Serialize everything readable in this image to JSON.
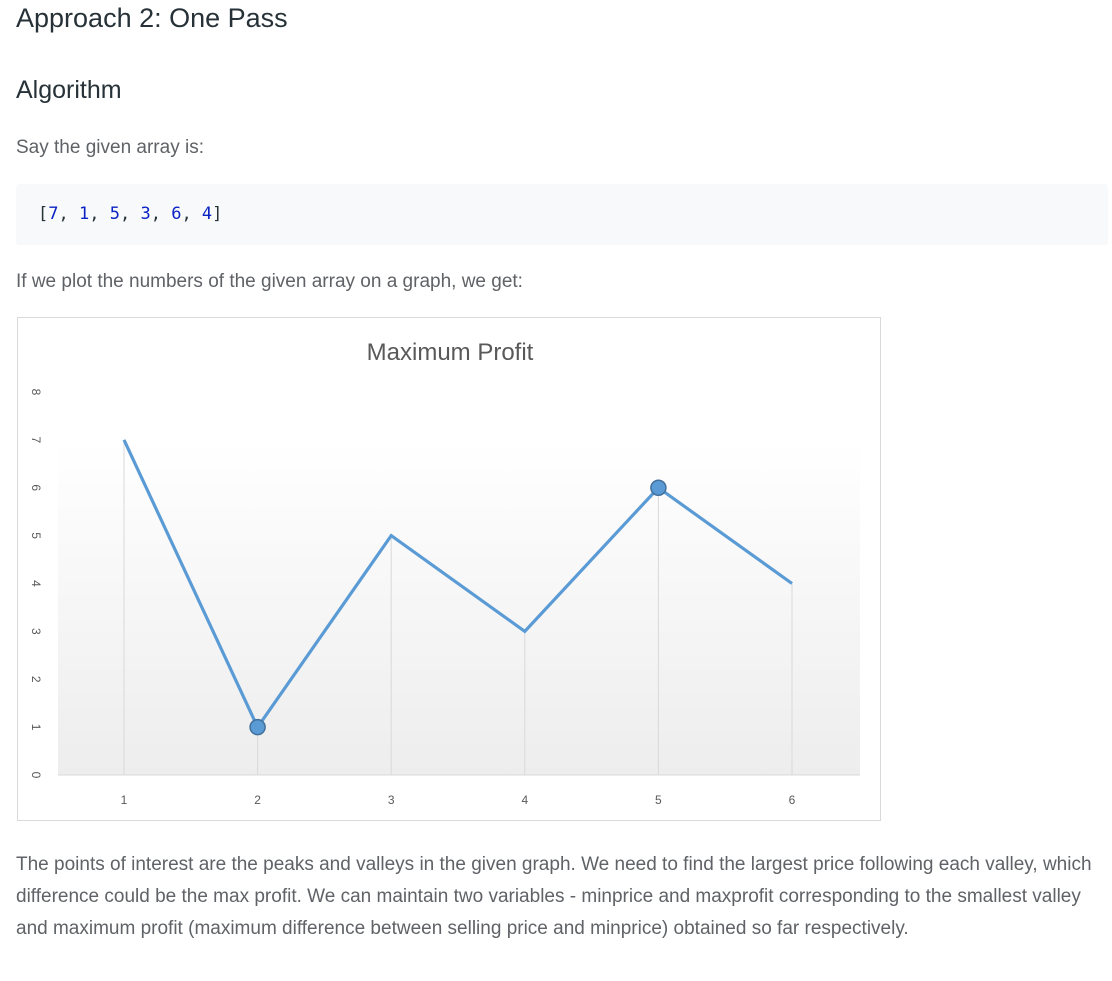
{
  "heading": "Approach 2: One Pass",
  "subheading": "Algorithm",
  "intro_text": "Say the given array is:",
  "code": {
    "open": "[",
    "close": "]",
    "separator": ", ",
    "values": [
      "7",
      "1",
      "5",
      "3",
      "6",
      "4"
    ]
  },
  "plot_text": "If we plot the numbers of the given array on a graph, we get:",
  "explanation": "The points of interest are the peaks and valleys in the given graph. We need to find the largest price following each valley, which difference could be the max profit. We can maintain two variables - minprice and maxprofit corresponding to the smallest valley and maximum profit (maximum difference between selling price and minprice) obtained so far respectively.",
  "colors": {
    "line": "#5b9bd5",
    "marker": "#5b9bd5",
    "marker_outline": "#41719c",
    "code_number": "#0b22c4",
    "heading": "#263238",
    "body_text": "#5f6266"
  },
  "chart_data": {
    "type": "line",
    "title": "Maximum Profit",
    "x": [
      1,
      2,
      3,
      4,
      5,
      6
    ],
    "categories": [
      "1",
      "2",
      "3",
      "4",
      "5",
      "6"
    ],
    "series": [
      {
        "values": [
          7,
          1,
          5,
          3,
          6,
          4
        ]
      }
    ],
    "highlighted_points": [
      {
        "x": 2,
        "y": 1
      },
      {
        "x": 5,
        "y": 6
      }
    ],
    "y_ticks": [
      "0",
      "1",
      "2",
      "3",
      "4",
      "5",
      "6",
      "7",
      "8"
    ],
    "ylim": [
      0,
      8
    ],
    "ytick_rotation": "rotated",
    "grid": "vertical drop lines at each category",
    "legend": "none",
    "xlabel": "",
    "ylabel": ""
  }
}
